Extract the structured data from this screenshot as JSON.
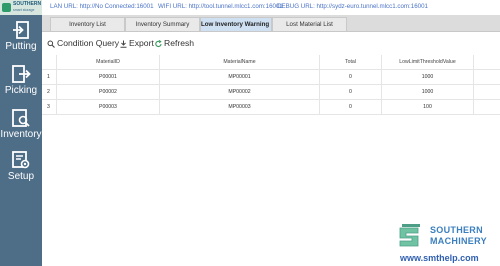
{
  "logo": {
    "line1": "SOUTHERN",
    "line2": "smart storage"
  },
  "sidebar": {
    "items": [
      {
        "label": "Putting",
        "icon": "putting-icon"
      },
      {
        "label": "Picking",
        "icon": "picking-icon"
      },
      {
        "label": "Inventory",
        "icon": "inventory-icon"
      },
      {
        "label": "Setup",
        "icon": "setup-icon"
      }
    ]
  },
  "status": {
    "lan": "LAN URL: http://No Connected:16001",
    "wifi": "WIFI URL: http://tool.tunnel.mlcc1.com:16001",
    "debug": "DEBUG URL: http://sydz-euro.tunnel.mlcc1.com:16001"
  },
  "tabs": [
    {
      "label": "Inventory List",
      "active": false
    },
    {
      "label": "Inventory Summary",
      "active": false
    },
    {
      "label": "Low Inventory Warning Li",
      "active": true
    },
    {
      "label": "Lost Material List",
      "active": false
    }
  ],
  "toolbar": {
    "condition_query": "Condition Query",
    "export": "Export",
    "refresh": "Refresh"
  },
  "table": {
    "columns": [
      "",
      "MaterialID",
      "MaterialName",
      "Total",
      "LowLimitThresholdValue"
    ],
    "rows": [
      [
        "1",
        "P00001",
        "MP00001",
        "0",
        "1000"
      ],
      [
        "2",
        "P00002",
        "MP00002",
        "0",
        "1000"
      ],
      [
        "3",
        "P00003",
        "MP00003",
        "0",
        "100"
      ]
    ]
  },
  "brand": {
    "line1": "SOUTHERN",
    "line2": "MACHINERY",
    "site": "www.smthelp.com"
  },
  "colors": {
    "sidebar": "#4e6d87",
    "active_tab": "#cfe0f3",
    "link": "#4a73c7",
    "brand": "#3b7fbf"
  }
}
